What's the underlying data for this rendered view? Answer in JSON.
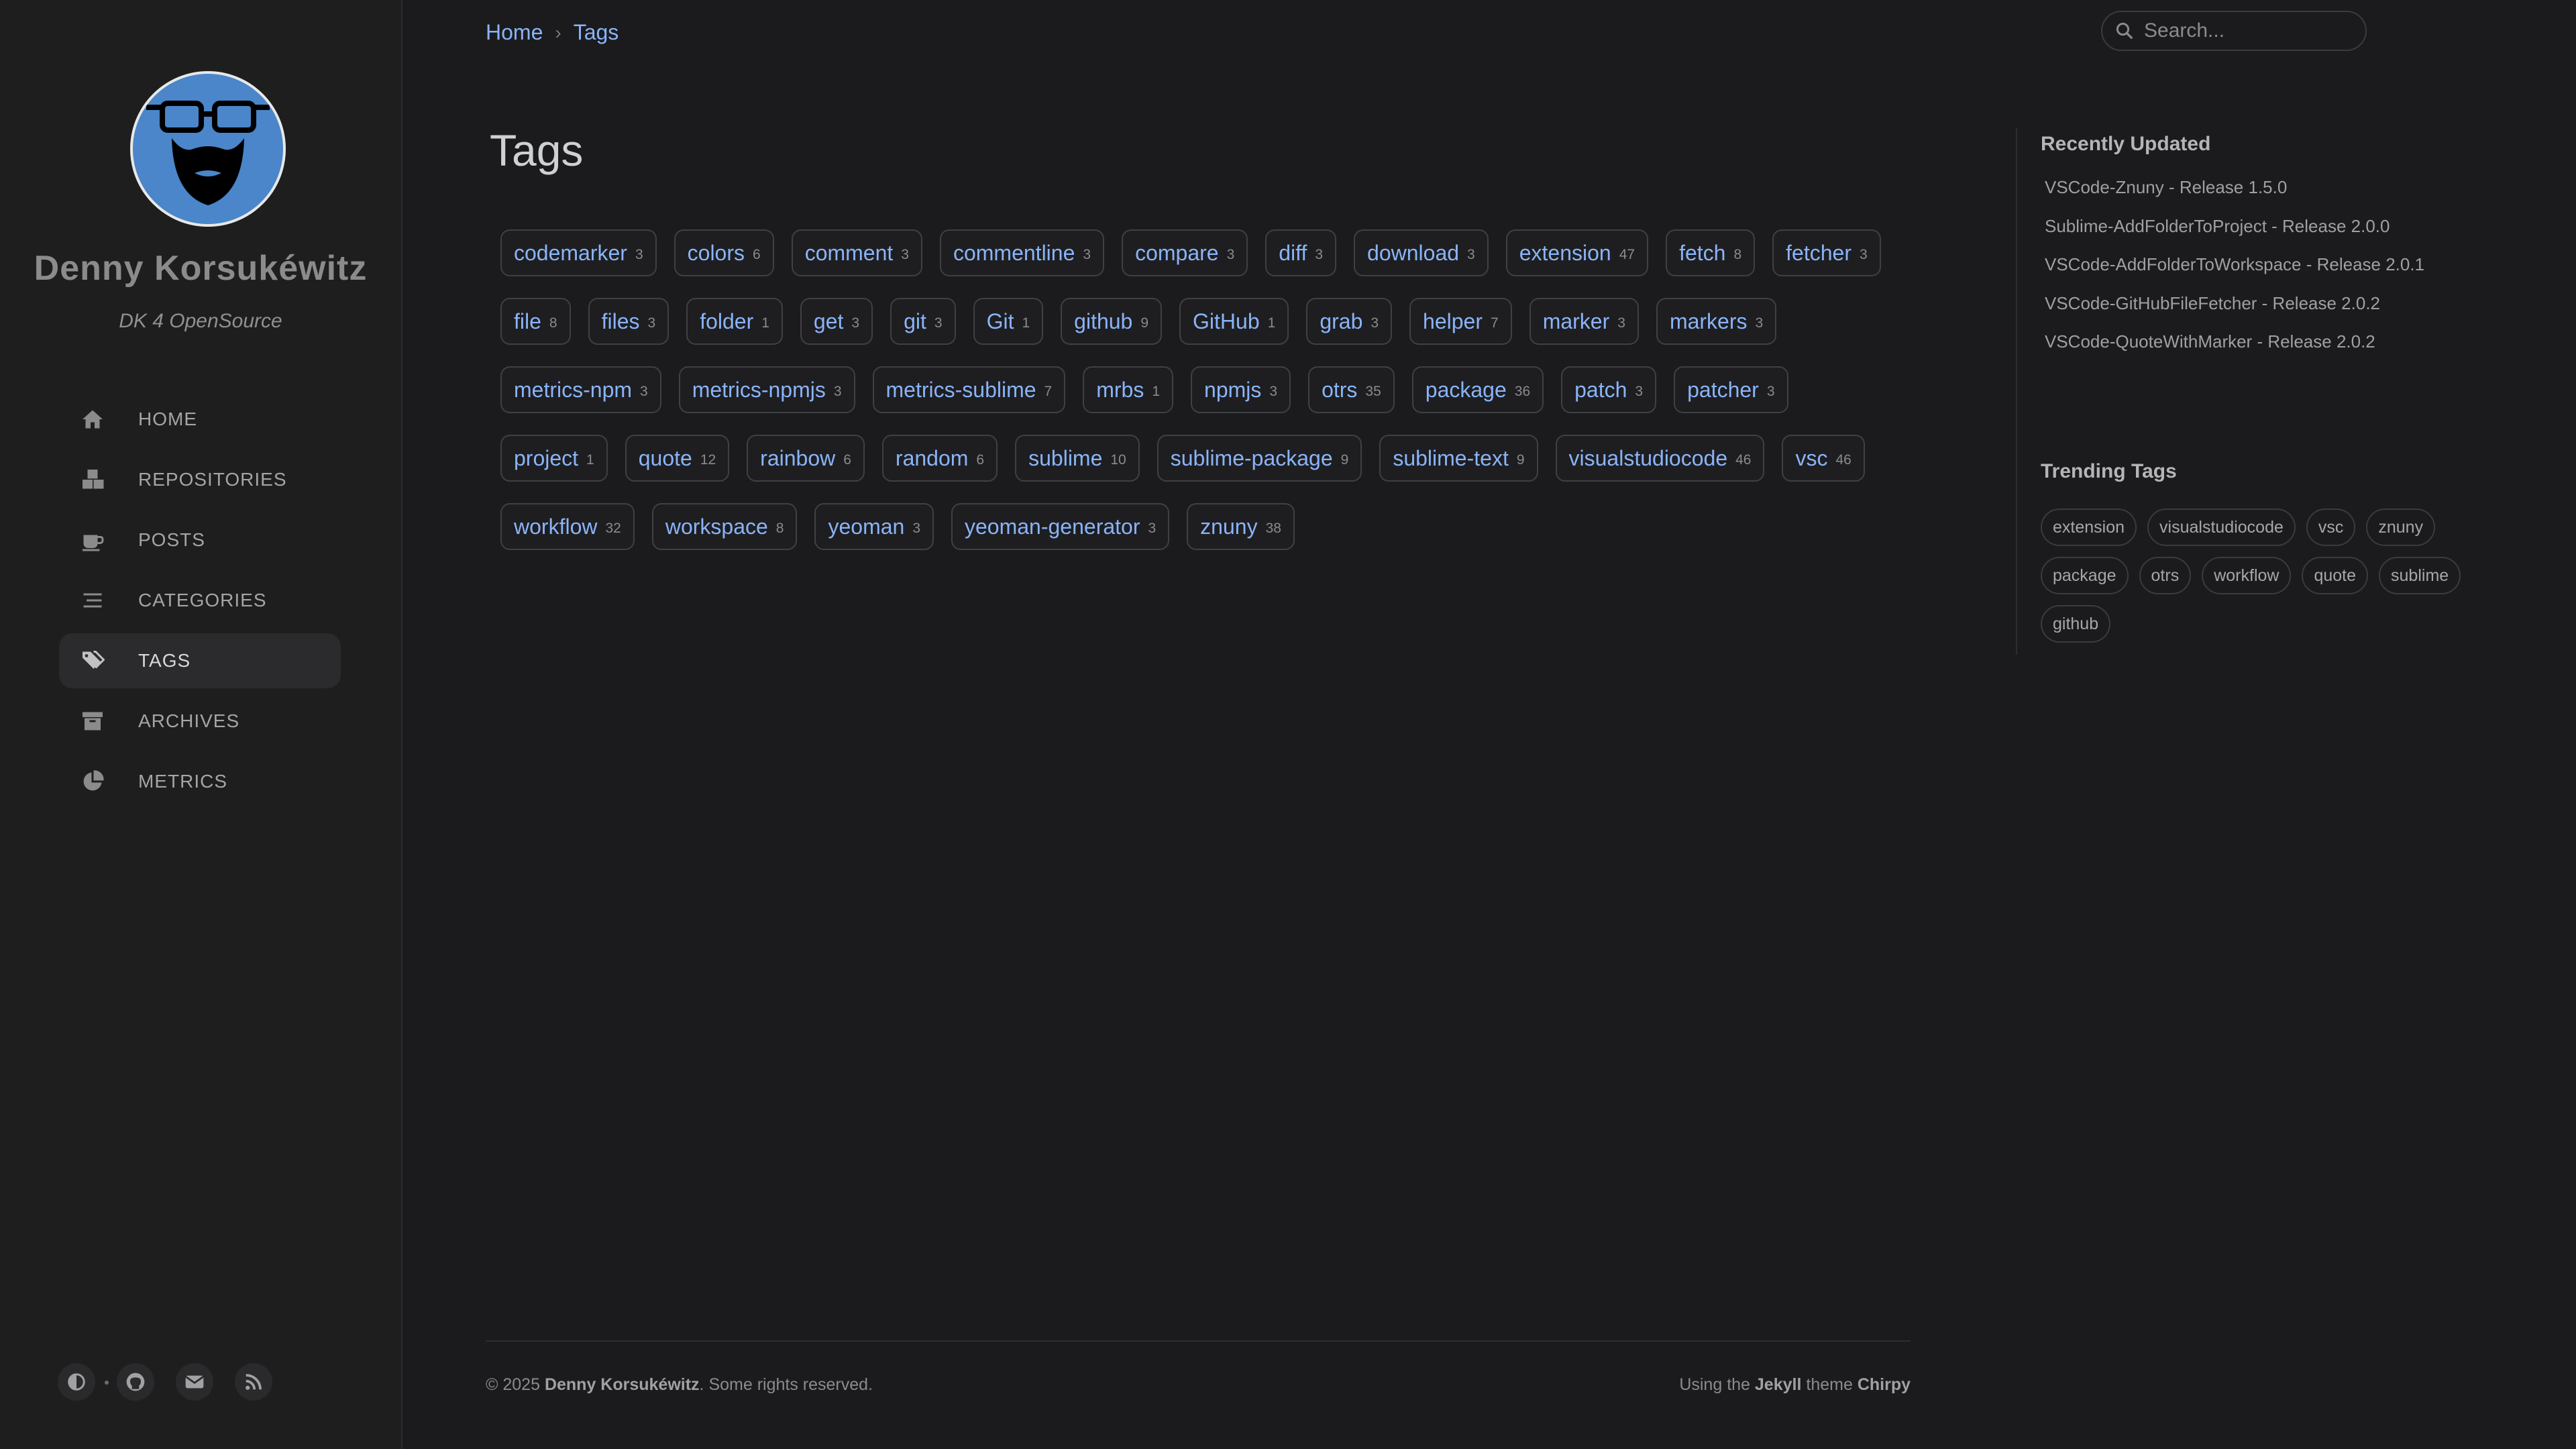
{
  "sidebar": {
    "title": "Denny Korsukéwitz",
    "subtitle": "DK 4 OpenSource",
    "items": [
      {
        "label": "HOME",
        "icon": "home-icon"
      },
      {
        "label": "REPOSITORIES",
        "icon": "cubes-icon"
      },
      {
        "label": "POSTS",
        "icon": "coffee-icon"
      },
      {
        "label": "CATEGORIES",
        "icon": "stream-icon"
      },
      {
        "label": "TAGS",
        "icon": "tags-icon",
        "active": true
      },
      {
        "label": "ARCHIVES",
        "icon": "archive-icon"
      },
      {
        "label": "METRICS",
        "icon": "chart-pie-icon"
      }
    ],
    "bottom_icons": [
      "theme-toggle-icon",
      "github-icon",
      "email-icon",
      "rss-icon"
    ]
  },
  "breadcrumb": {
    "home": "Home",
    "separator": "›",
    "current": "Tags"
  },
  "search": {
    "placeholder": "Search..."
  },
  "main": {
    "title": "Tags",
    "tags": [
      {
        "name": "codemarker",
        "count": "3"
      },
      {
        "name": "colors",
        "count": "6"
      },
      {
        "name": "comment",
        "count": "3"
      },
      {
        "name": "commentline",
        "count": "3"
      },
      {
        "name": "compare",
        "count": "3"
      },
      {
        "name": "diff",
        "count": "3"
      },
      {
        "name": "download",
        "count": "3"
      },
      {
        "name": "extension",
        "count": "47"
      },
      {
        "name": "fetch",
        "count": "8"
      },
      {
        "name": "fetcher",
        "count": "3"
      },
      {
        "name": "file",
        "count": "8"
      },
      {
        "name": "files",
        "count": "3"
      },
      {
        "name": "folder",
        "count": "1"
      },
      {
        "name": "get",
        "count": "3"
      },
      {
        "name": "git",
        "count": "3"
      },
      {
        "name": "Git",
        "count": "1"
      },
      {
        "name": "github",
        "count": "9"
      },
      {
        "name": "GitHub",
        "count": "1"
      },
      {
        "name": "grab",
        "count": "3"
      },
      {
        "name": "helper",
        "count": "7"
      },
      {
        "name": "marker",
        "count": "3"
      },
      {
        "name": "markers",
        "count": "3"
      },
      {
        "name": "metrics-npm",
        "count": "3"
      },
      {
        "name": "metrics-npmjs",
        "count": "3"
      },
      {
        "name": "metrics-sublime",
        "count": "7"
      },
      {
        "name": "mrbs",
        "count": "1"
      },
      {
        "name": "npmjs",
        "count": "3"
      },
      {
        "name": "otrs",
        "count": "35"
      },
      {
        "name": "package",
        "count": "36"
      },
      {
        "name": "patch",
        "count": "3"
      },
      {
        "name": "patcher",
        "count": "3"
      },
      {
        "name": "project",
        "count": "1"
      },
      {
        "name": "quote",
        "count": "12"
      },
      {
        "name": "rainbow",
        "count": "6"
      },
      {
        "name": "random",
        "count": "6"
      },
      {
        "name": "sublime",
        "count": "10"
      },
      {
        "name": "sublime-package",
        "count": "9"
      },
      {
        "name": "sublime-text",
        "count": "9"
      },
      {
        "name": "visualstudiocode",
        "count": "46"
      },
      {
        "name": "vsc",
        "count": "46"
      },
      {
        "name": "workflow",
        "count": "32"
      },
      {
        "name": "workspace",
        "count": "8"
      },
      {
        "name": "yeoman",
        "count": "3"
      },
      {
        "name": "yeoman-generator",
        "count": "3"
      },
      {
        "name": "znuny",
        "count": "38"
      }
    ]
  },
  "panel": {
    "recent_title": "Recently Updated",
    "recent": [
      "VSCode-Znuny - Release 1.5.0",
      "Sublime-AddFolderToProject - Release 2.0.0",
      "VSCode-AddFolderToWorkspace - Release 2.0.1",
      "VSCode-GitHubFileFetcher - Release 2.0.2",
      "VSCode-QuoteWithMarker - Release 2.0.2"
    ],
    "trending_title": "Trending Tags",
    "trending": [
      "extension",
      "visualstudiocode",
      "vsc",
      "znuny",
      "package",
      "otrs",
      "workflow",
      "quote",
      "sublime",
      "github"
    ]
  },
  "footer": {
    "copyright_prefix": "© 2025",
    "author": "Denny Korsukéwitz",
    "rights": ". Some rights reserved.",
    "using": "Using the",
    "jekyll": "Jekyll",
    "theme_word": "theme",
    "chirpy": "Chirpy"
  },
  "colors": {
    "accent": "#8ab4f8",
    "background": "#1b1b1e",
    "sidebar": "#1e1e1e",
    "avatar_bg": "#4a86c9"
  }
}
